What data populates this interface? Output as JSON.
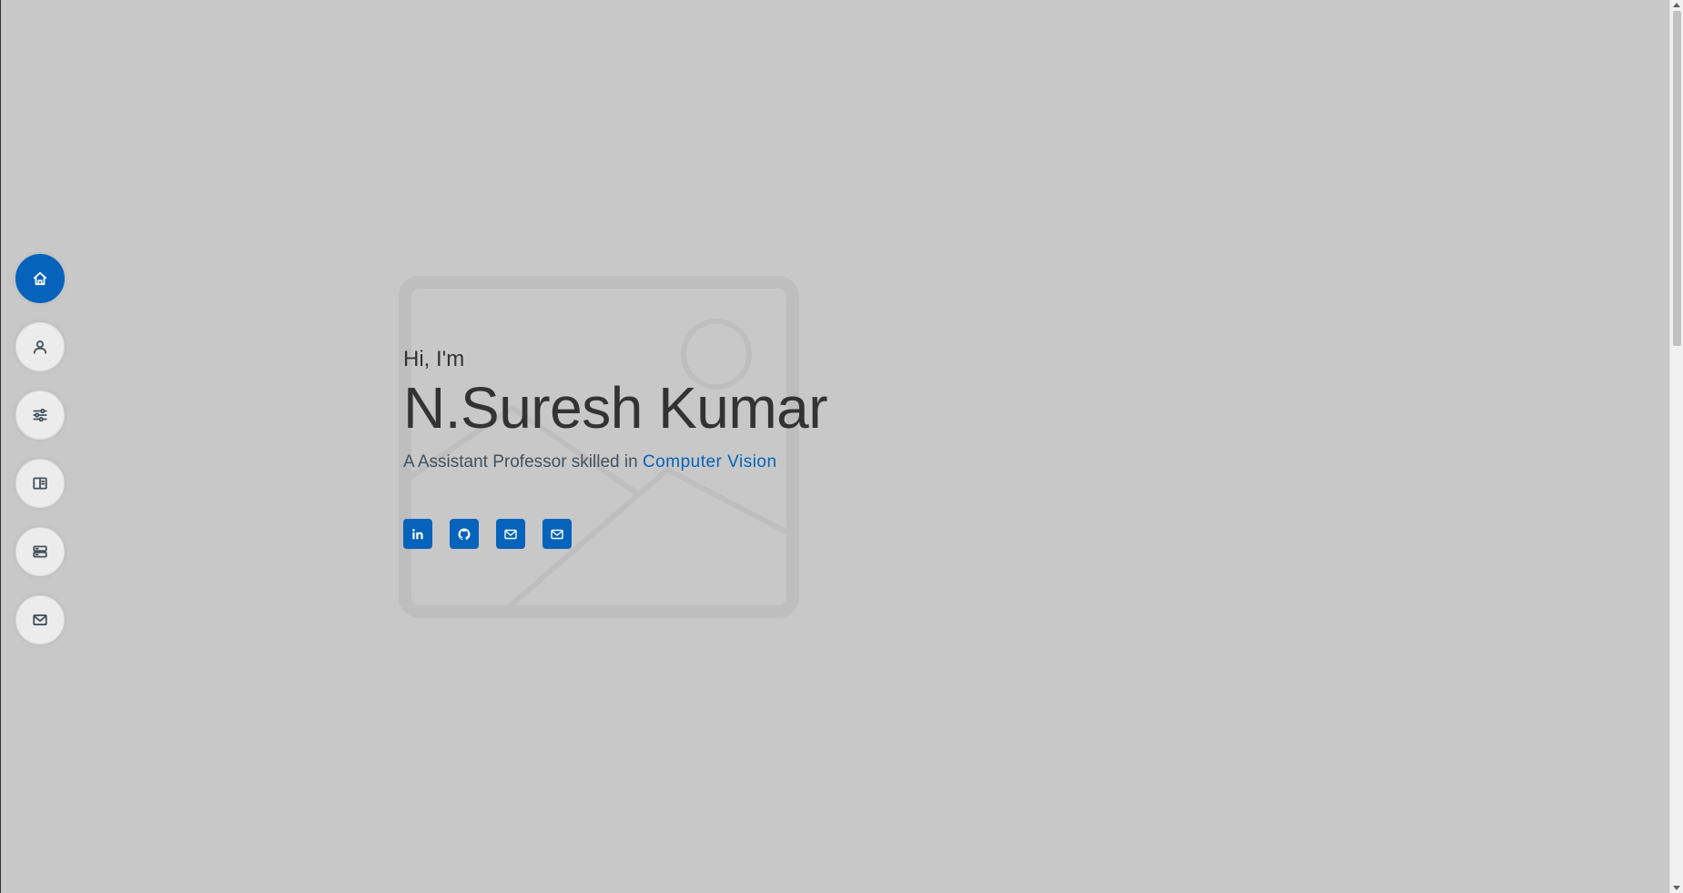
{
  "nav": {
    "items": [
      {
        "icon": "home-icon",
        "active": true
      },
      {
        "icon": "person-icon",
        "active": false
      },
      {
        "icon": "sliders-icon",
        "active": false
      },
      {
        "icon": "book-icon",
        "active": false
      },
      {
        "icon": "server-icon",
        "active": false
      },
      {
        "icon": "envelope-icon",
        "active": false
      }
    ]
  },
  "hero": {
    "greeting": "Hi, I'm",
    "name": "N.Suresh Kumar",
    "tagline_prefix": "A Assistant Professor skilled in ",
    "skill": "Computer Vision"
  },
  "socials": [
    {
      "icon": "linkedin-icon"
    },
    {
      "icon": "github-icon"
    },
    {
      "icon": "envelope-icon"
    },
    {
      "icon": "envelope-icon"
    }
  ],
  "colors": {
    "accent": "#0563bb",
    "background": "#c8c8c8",
    "text": "#45505b",
    "heading": "#333333"
  }
}
